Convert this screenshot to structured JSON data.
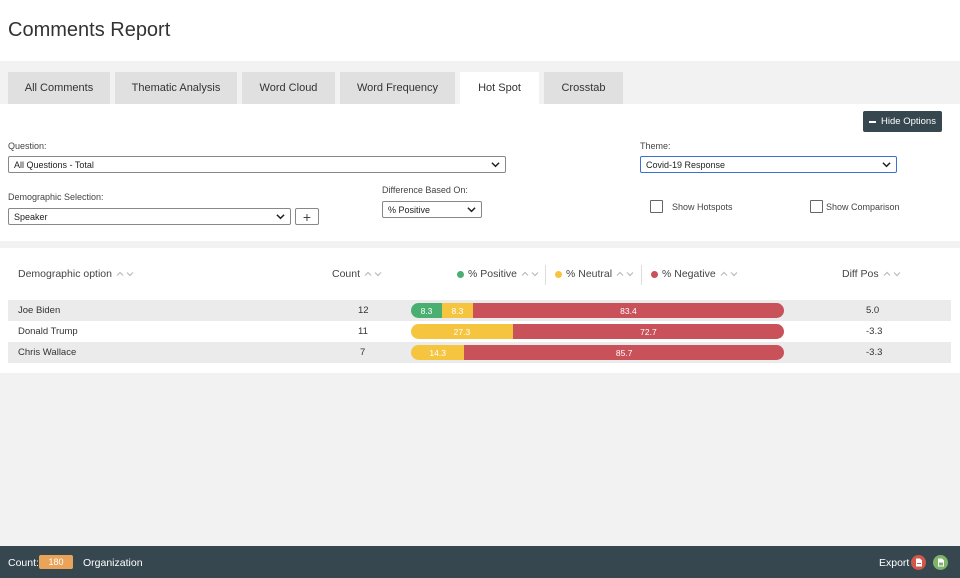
{
  "page": {
    "title": "Comments Report"
  },
  "tabs": [
    {
      "label": "All Comments",
      "active": false
    },
    {
      "label": "Thematic Analysis",
      "active": false
    },
    {
      "label": "Word Cloud",
      "active": false
    },
    {
      "label": "Word Frequency",
      "active": false
    },
    {
      "label": "Hot Spot",
      "active": true
    },
    {
      "label": "Crosstab",
      "active": false
    }
  ],
  "options": {
    "hide_label": "Hide Options",
    "question": {
      "label": "Question:",
      "value": "All Questions - Total"
    },
    "theme": {
      "label": "Theme:",
      "value": "Covid-19 Response"
    },
    "demographic": {
      "label": "Demographic Selection:",
      "value": "Speaker"
    },
    "difference": {
      "label": "Difference Based On:",
      "value": "% Positive"
    },
    "show_hotspots": {
      "label": "Show Hotspots",
      "checked": false
    },
    "show_comparison": {
      "label": "Show Comparison",
      "checked": false
    }
  },
  "table": {
    "headers": {
      "option": "Demographic option",
      "count": "Count",
      "positive": "% Positive",
      "neutral": "% Neutral",
      "negative": "% Negative",
      "diff": "Diff Pos"
    },
    "rows": [
      {
        "name": "Joe Biden",
        "count": "12",
        "positive": 8.3,
        "neutral": 8.3,
        "negative": 83.4,
        "positive_label": "8.3",
        "neutral_label": "8.3",
        "negative_label": "83.4",
        "diff": "5.0"
      },
      {
        "name": "Donald Trump",
        "count": "11",
        "positive": 0,
        "neutral": 27.3,
        "negative": 72.7,
        "positive_label": "",
        "neutral_label": "27.3",
        "negative_label": "72.7",
        "diff": "-3.3"
      },
      {
        "name": "Chris Wallace",
        "count": "7",
        "positive": 0,
        "neutral": 14.3,
        "negative": 85.7,
        "positive_label": "",
        "neutral_label": "14.3",
        "negative_label": "85.7",
        "diff": "-3.3"
      }
    ]
  },
  "colors": {
    "positive": "#4caf72",
    "neutral": "#f5c540",
    "negative": "#c9515a",
    "footer": "#37474f",
    "badge": "#e9a45a",
    "focus": "#3b6fd6"
  },
  "footer": {
    "count_label": "Count:",
    "count_value": "180",
    "org_label": "Organization",
    "export_label": "Export",
    "pdf_icon": "pdf-icon",
    "excel_icon": "excel-icon"
  }
}
